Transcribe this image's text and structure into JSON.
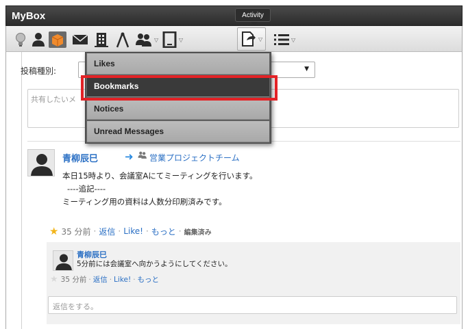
{
  "window": {
    "title": "MyBox"
  },
  "toolbar": {
    "icons": [
      "bulb-icon",
      "person-icon",
      "box-icon",
      "mail-icon",
      "building-icon",
      "compass-icon",
      "group-icon",
      "tablet-icon",
      "share-icon",
      "list-icon"
    ],
    "tooltip": "Activity"
  },
  "form": {
    "post_type_label": "投稿種別:",
    "share_placeholder": "共有したいメ"
  },
  "dropdown": {
    "items": [
      "Likes",
      "Bookmarks",
      "Notices",
      "Unread Messages"
    ],
    "selected": "Bookmarks",
    "highlight_color": "#e32226"
  },
  "post": {
    "author": "青柳辰巳",
    "group": "営業プロジェクトチーム",
    "lines": [
      "本日15時より、会議室Aにてミーティングを行います。",
      "----追記----",
      "ミーティング用の資料は人数分印刷済みです。"
    ],
    "time": "35 分前",
    "reply_link": "返信",
    "like_link": "Like!",
    "more_link": "もっと",
    "edited": "編集済み",
    "starred": true
  },
  "reply": {
    "author": "青柳辰巳",
    "text": "5分前には会議室へ向かうようにしてください。",
    "time": "35 分前",
    "reply_link": "返信",
    "like_link": "Like!",
    "more_link": "もっと",
    "starred": false,
    "input_placeholder": "返信をする。"
  },
  "colors": {
    "link": "#2a6fc4",
    "star": "#f2b51b",
    "titlebar": "#2c2c2c"
  }
}
